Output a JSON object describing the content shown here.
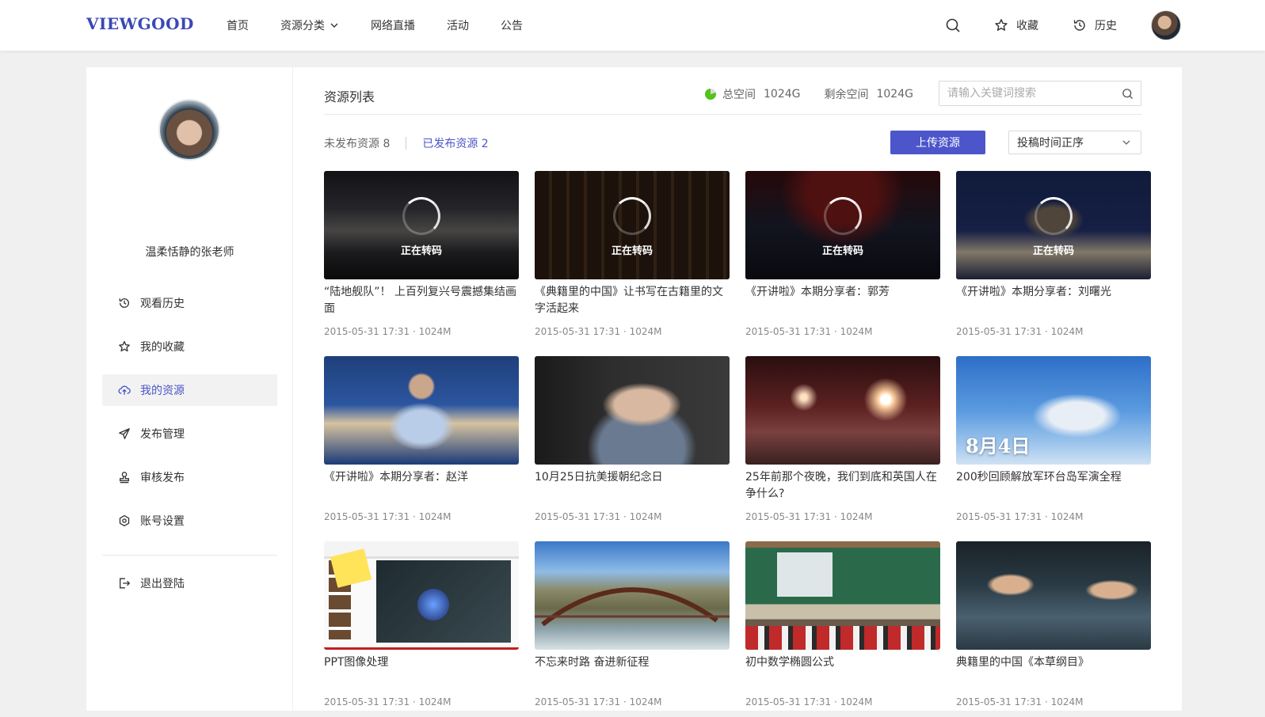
{
  "header": {
    "logo": "VIEWGOOD",
    "nav": [
      "首页",
      "资源分类",
      "网络直播",
      "活动",
      "公告"
    ],
    "favorites_label": "收藏",
    "history_label": "历史"
  },
  "sidebar": {
    "username": "温柔恬静的张老师",
    "items": [
      {
        "label": "观看历史",
        "icon": "history-icon"
      },
      {
        "label": "我的收藏",
        "icon": "star-icon"
      },
      {
        "label": "我的资源",
        "icon": "cloud-upload-icon"
      },
      {
        "label": "发布管理",
        "icon": "send-icon"
      },
      {
        "label": "审核发布",
        "icon": "stamp-icon"
      },
      {
        "label": "账号设置",
        "icon": "settings-icon"
      }
    ],
    "logout_label": "退出登陆"
  },
  "content": {
    "title": "资源列表",
    "total_space_label": "总空间",
    "total_space_value": "1024G",
    "free_space_label": "剩余空间",
    "free_space_value": "1024G",
    "search_placeholder": "请输入关键词搜索",
    "tab_unpublished": "未发布资源 8",
    "tab_published": "已发布资源 2",
    "upload_label": "上传资源",
    "sort_value": "投稿时间正序",
    "transcoding_label": "正在转码",
    "videos": [
      {
        "title": "“陆地舰队”！ 上百列复兴号震撼集结画面",
        "meta": "2015-05-31 17:31 · 1024M",
        "transcoding": true
      },
      {
        "title": "《典籍里的中国》让书写在古籍里的文字活起来",
        "meta": "2015-05-31 17:31 · 1024M",
        "transcoding": true
      },
      {
        "title": "《开讲啦》本期分享者：郭芳",
        "meta": "2015-05-31 17:31 · 1024M",
        "transcoding": true
      },
      {
        "title": "《开讲啦》本期分享者：刘曙光",
        "meta": "2015-05-31 17:31 · 1024M",
        "transcoding": true
      },
      {
        "title": "《开讲啦》本期分享者：赵洋",
        "meta": "2015-05-31 17:31 · 1024M",
        "transcoding": false
      },
      {
        "title": "10月25日抗美援朝纪念日",
        "meta": "2015-05-31 17:31 · 1024M",
        "transcoding": false
      },
      {
        "title": "25年前那个夜晚，我们到底和英国人在争什么?",
        "meta": "2015-05-31 17:31 · 1024M",
        "transcoding": false
      },
      {
        "title": "200秒回顾解放军环台岛军演全程",
        "meta": "2015-05-31 17:31 · 1024M",
        "transcoding": false
      },
      {
        "title": "PPT图像处理",
        "meta": "2015-05-31 17:31 · 1024M",
        "transcoding": false
      },
      {
        "title": "不忘来时路 奋进新征程",
        "meta": "2015-05-31 17:31 · 1024M",
        "transcoding": false
      },
      {
        "title": "初中数学椭圆公式",
        "meta": "2015-05-31 17:31 · 1024M",
        "transcoding": false
      },
      {
        "title": "典籍里的中国《本草纲目》",
        "meta": "2015-05-31 17:31 · 1024M",
        "transcoding": false
      }
    ],
    "thumb_overlay_text": "8月4日"
  },
  "colors": {
    "accent": "#4c55c9",
    "logo": "#3b48b5",
    "space_ok": "#52c41a"
  }
}
